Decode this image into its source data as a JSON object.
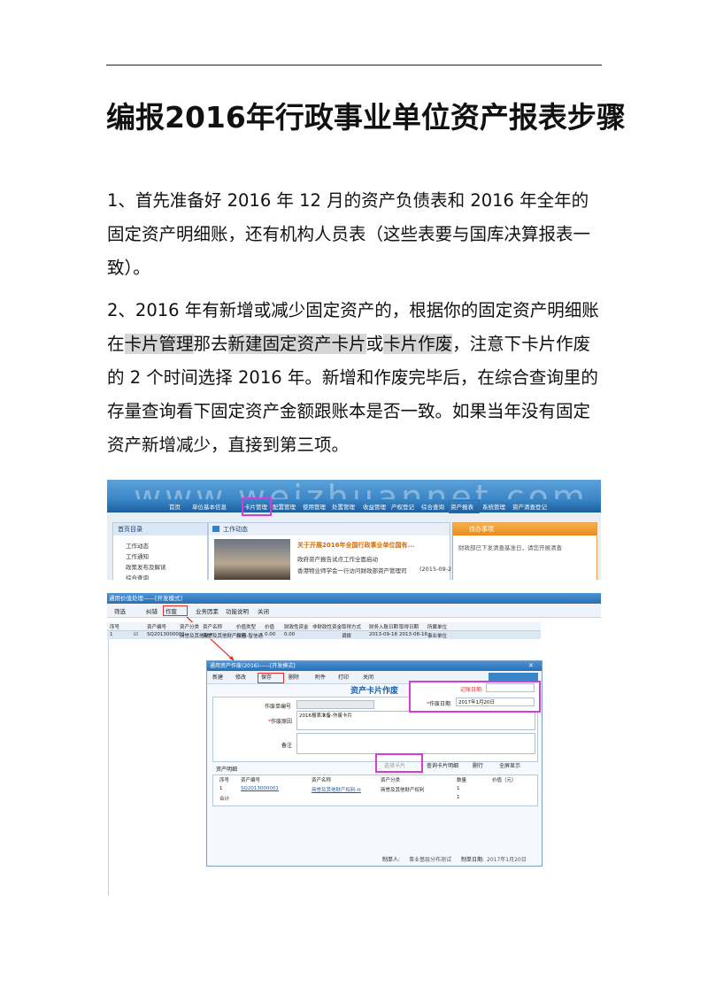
{
  "document": {
    "title": "编报2016年行政事业单位资产报表步骤",
    "step1": "1、首先准备好 2016 年 12 月的资产负债表和 2016 年全年的固定资产明细账，还有机构人员表（这些表要与国库决算报表一致）。",
    "step2_parts": {
      "p1": "2、2016 年有新增或减少固定资产的，根据你的固定资产明细账在",
      "h1": "卡片管理",
      "p2": "那去",
      "h2": "新建固定资产卡片",
      "p3": "或",
      "h3": "卡片作废",
      "p4": "，注意下卡片作废的 2 个时间选择 2016 年。新增和作废完毕后，在综合查询里的存量查询看下固定资产金额跟账本是否一致。如果当年没有固定资产新增减少，直接到第三项。"
    }
  },
  "screenshot1": {
    "watermark": "www.weizhuannet.com",
    "nav": [
      "首页",
      "单位基本信息",
      "卡片管理",
      "配置管理",
      "使用管理",
      "处置管理",
      "收益管理",
      "产权登记",
      "综合查询",
      "资产报表",
      "系统管理",
      "资产清查登记"
    ],
    "left_panel": {
      "header": "首页目录",
      "items": [
        "工作动态",
        "工作通知",
        "政策发布及解读",
        "综合查询"
      ]
    },
    "center_panel": {
      "header": "工作动态",
      "news_title": "关于开展2016年全国行政事业单位国有...",
      "news_lines": [
        "政府资产报告试点工作全面启动",
        "香港物业师学会一行访问财政部资产管理司"
      ],
      "news_date": "(2015-09-2"
    },
    "right_panel": {
      "header": "待办事项",
      "item": "财政部已下发清查基准日，请您开展清查"
    }
  },
  "screenshot2": {
    "window_title": "通用价值处理——[开发模式]",
    "toolbar": [
      "筛选",
      "纠错",
      "作废",
      "业务因素",
      "功能说明",
      "关闭"
    ],
    "grid_headers": [
      "序号",
      "",
      "资产编号",
      "资产分类",
      "资产名称",
      "价值类型",
      "价值",
      "财政性资金",
      "非财政性资金",
      "取得方式",
      "财务入账日期",
      "取得日期",
      "所属单位"
    ],
    "grid_row": [
      "1",
      "☑",
      "SQ2013000001",
      "商誉及其他财产",
      "商誉及其他财产权利-智信通",
      "原值",
      "0.00",
      "0.00",
      "",
      "调拨",
      "2013-09-18",
      "2013-08-16",
      "事业单位"
    ],
    "dialog": {
      "title": "通用资产作废(2016)——[开发模式]",
      "toolbar": [
        "新建",
        "修改",
        "保存",
        "删除",
        "附件",
        "打印",
        "关闭"
      ],
      "heading": "资产卡片作废",
      "record_date_label": "记账日期:",
      "void_no_label": "作废单编号",
      "void_date_label": "作废日期",
      "void_date_value": "2017年1月20日",
      "void_reason_label": "作废原因",
      "void_reason_value": "2016报表准备-作废卡片",
      "remark_label": "备注",
      "detail_title": "资产明细",
      "detail_buttons": [
        "选择卡片",
        "查询卡片明细",
        "删行",
        "全屏显示"
      ],
      "detail_headers": [
        "序号",
        "资产编号",
        "资产名称",
        "资产分类",
        "数量",
        "价值（元）"
      ],
      "detail_rows": [
        [
          "1",
          "SQ2013000001",
          "商誉及其他财产权利-tt",
          "商誉及其他财产权利",
          "1",
          ""
        ],
        [
          "合计",
          "",
          "",
          "",
          "1",
          ""
        ]
      ],
      "footer_maker_label": "制单人:",
      "footer_maker_value": "事业基层分布测试",
      "footer_date_label": "制单日期:",
      "footer_date_value": "2017年1月20日"
    }
  }
}
